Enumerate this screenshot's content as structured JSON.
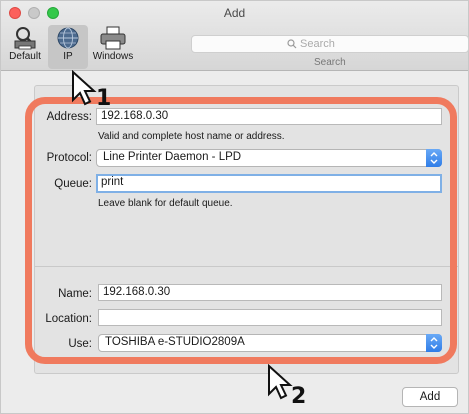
{
  "window": {
    "title": "Add"
  },
  "toolbar": {
    "items": [
      {
        "label": "Default"
      },
      {
        "label": "IP"
      },
      {
        "label": "Windows"
      }
    ],
    "search": {
      "placeholder": "Search",
      "label": "Search"
    }
  },
  "form": {
    "address": {
      "label": "Address:",
      "value": "192.168.0.30",
      "hint": "Valid and complete host name or address."
    },
    "protocol": {
      "label": "Protocol:",
      "value": "Line Printer Daemon - LPD"
    },
    "queue": {
      "label": "Queue:",
      "value": "print",
      "hint": "Leave blank for default queue."
    },
    "name": {
      "label": "Name:",
      "value": "192.168.0.30"
    },
    "location": {
      "label": "Location:",
      "value": ""
    },
    "use": {
      "label": "Use:",
      "value": "TOSHIBA e-STUDIO2809A"
    }
  },
  "buttons": {
    "add": "Add"
  },
  "callouts": {
    "first": "1",
    "second": "2"
  },
  "colors": {
    "highlight": "#f07a5e",
    "accent": "#2f7de8",
    "focus": "#7fb0e6"
  }
}
